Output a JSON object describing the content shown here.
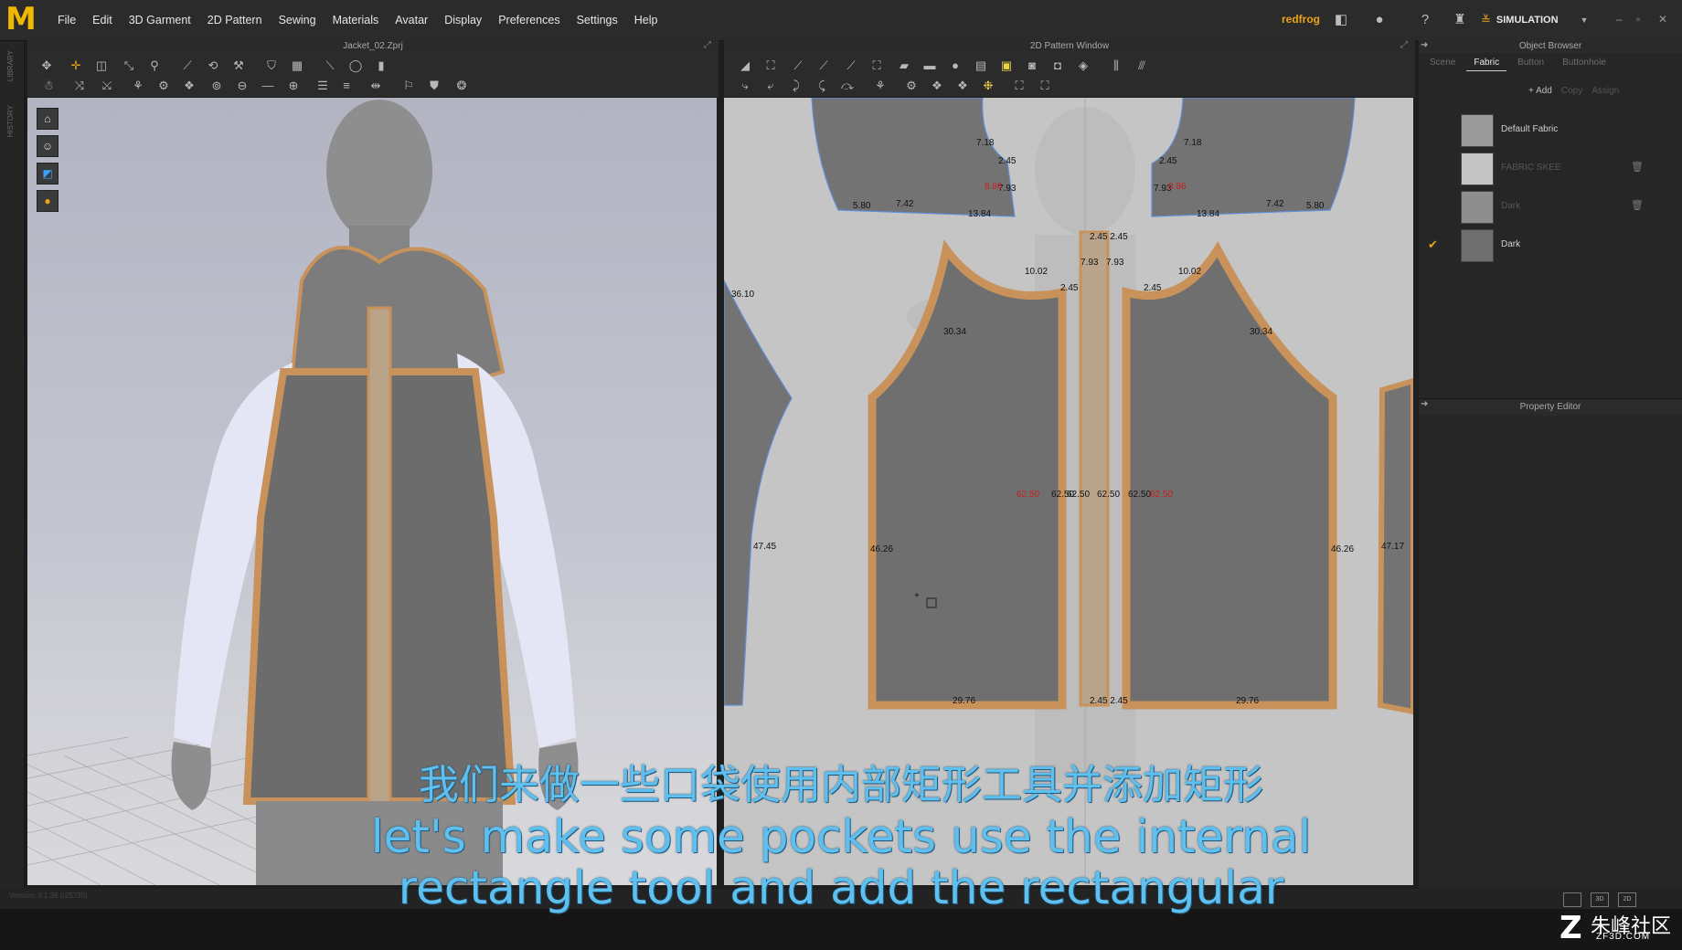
{
  "app": {
    "logo": "M",
    "menu": [
      "File",
      "Edit",
      "3D Garment",
      "2D Pattern",
      "Sewing",
      "Materials",
      "Avatar",
      "Display",
      "Preferences",
      "Settings",
      "Help"
    ],
    "user": "redfrog",
    "mode": "SIMULATION",
    "window_controls": [
      "–",
      "▫",
      "✕"
    ]
  },
  "left_strip": [
    "LIBRARY",
    "HISTORY"
  ],
  "panel3d": {
    "title": "Jacket_02.Zprj"
  },
  "panel2d": {
    "title": "2D Pattern Window",
    "measurements": {
      "armhole_top_l": "7.18",
      "armhole_top_r": "7.18",
      "notch_l": "2.45",
      "notch_r": "2.45",
      "side_l": "7.93",
      "side_r": "7.93",
      "red_l": "8.86",
      "red_r": "8.86",
      "hem_l1": "5.80",
      "hem_l2": "7.42",
      "hem_l3": "13.84",
      "hem_r1": "13.84",
      "hem_r2": "7.42",
      "hem_r3": "5.80",
      "zip_top": "2.45 2.45",
      "zip_a": "7.93",
      "zip_b": "7.93",
      "raglan_l": "10.02",
      "raglan_r": "10.02",
      "raglan_notch_l": "2.45",
      "raglan_notch_r": "2.45",
      "curve_l": "30.34",
      "curve_r": "30.34",
      "sleeve_l_top": "36.10",
      "sleeve_l_side": "47.45",
      "sleeve_r_side": "47.17",
      "front_l": "46.26",
      "front_r": "46.26",
      "center_1": "62.50",
      "center_2": "62.50",
      "center_3": "62.50",
      "center_4": "62.50",
      "center_red_1": "62.50",
      "center_red_2": "62.50",
      "hem_front_l": "29.76",
      "hem_front_r": "29.76",
      "hem_zip": "2.45 2.45"
    }
  },
  "object_browser": {
    "title": "Object Browser",
    "tabs": [
      "Scene",
      "Fabric",
      "Button",
      "Buttonhole"
    ],
    "active_tab": "Fabric",
    "actions": [
      "+ Add",
      "Copy",
      "Assign"
    ],
    "fabrics": [
      {
        "name": "Default Fabric",
        "color": "#9b9b9b",
        "dim": false,
        "selected": false
      },
      {
        "name": "FABRIC SKEE",
        "color": "#c4c4c4",
        "dim": true,
        "selected": false
      },
      {
        "name": "Dark",
        "color": "#8e8e8e",
        "dim": true,
        "selected": false
      },
      {
        "name": "Dark",
        "color": "#6f6f6f",
        "dim": false,
        "selected": true
      }
    ]
  },
  "property_editor": {
    "title": "Property Editor"
  },
  "status": {
    "version": "Version: 3.1.36 (r25735)",
    "view_modes": [
      "",
      "3D",
      "2D"
    ]
  },
  "subtitle": {
    "zh": "我们来做一些口袋使用内部矩形工具并添加矩形",
    "en1": "let's make some pockets use the internal",
    "en2": "rectangle tool and add the rectangular"
  },
  "watermark": {
    "mark": "Z",
    "cn": "朱峰社区",
    "en": "ZF3D.COM"
  },
  "colors": {
    "accent": "#e9a21a",
    "pattern_piece": "#707070",
    "seam": "#c8925a",
    "subtitle": "#5ec0f0"
  }
}
